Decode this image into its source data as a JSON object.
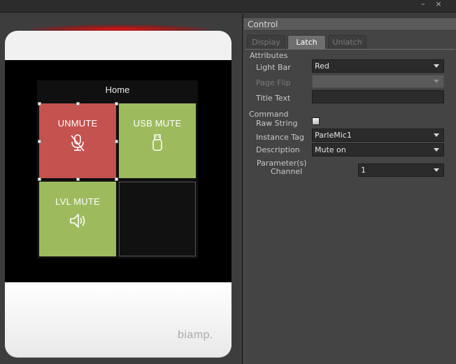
{
  "window": {
    "close_glyph": "×"
  },
  "device": {
    "page_title": "Home",
    "brand": "biamp.",
    "tiles": [
      {
        "label": "UNMUTE",
        "icon": "mic-muted-icon",
        "color": "#c4524f"
      },
      {
        "label": "USB MUTE",
        "icon": "usb-stick-icon",
        "color": "#9dbb5d"
      },
      {
        "label": "LVL MUTE",
        "icon": "speaker-icon",
        "color": "#9dbb5d"
      }
    ],
    "light_bar_color": "#d21414"
  },
  "control": {
    "title": "Control",
    "tabs": [
      "Display",
      "Latch",
      "Unlatch"
    ],
    "active_tab": "Latch",
    "attributes_label": "Attributes",
    "light_bar": {
      "label": "Light Bar",
      "value": "Red"
    },
    "page_flip": {
      "label": "Page Flip",
      "value": ""
    },
    "title_text": {
      "label": "Title Text",
      "value": ""
    },
    "command_label": "Command",
    "raw_string": {
      "label": "Raw String",
      "checked": false
    },
    "instance_tag": {
      "label": "Instance Tag",
      "value": "ParleMic1"
    },
    "description": {
      "label": "Description",
      "value": "Mute on"
    },
    "parameters_label": "Parameter(s)",
    "channel": {
      "label": "Channel",
      "value": "1"
    }
  }
}
